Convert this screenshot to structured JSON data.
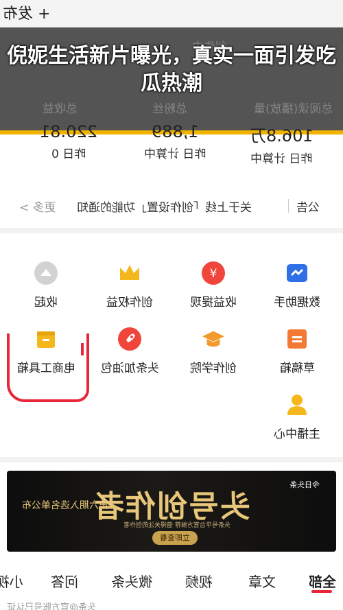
{
  "topbar": {
    "publish_label": "+ 发布"
  },
  "overlay": {
    "caption": "倪妮生活新片曝光，真实一面引发吃瓜热潮",
    "ghost_texts": [
      "创作中",
      "总阅读(播放)量",
      "总粉丝",
      "总收益"
    ]
  },
  "stats": [
    {
      "value": "106.8万",
      "label": "昨日 计算中"
    },
    {
      "value": "1,889",
      "label": "昨日 计算中"
    },
    {
      "value": "220.81",
      "label": "昨日 0"
    }
  ],
  "notice": {
    "tag": "公告",
    "text1": "关于上线「创作设置」功能的通知",
    "more": "更多 >"
  },
  "tools": [
    {
      "label": "数据助手",
      "icon": "chart-icon",
      "color": "#2f6fe8"
    },
    {
      "label": "收益提现",
      "icon": "yuan-icon",
      "color": "#f0453a"
    },
    {
      "label": "创作权益",
      "icon": "crown-icon",
      "color": "#f5b81c"
    },
    {
      "label": "收起",
      "icon": "collapse-icon",
      "color": "#bdbdbd"
    },
    {
      "label": "草稿箱",
      "icon": "draft-icon",
      "color": "#f27a35"
    },
    {
      "label": "创作学院",
      "icon": "graduation-icon",
      "color": "#f29a2e"
    },
    {
      "label": "头条加油包",
      "icon": "rocket-icon",
      "color": "#f0453a"
    },
    {
      "label": "电商工具箱",
      "icon": "box-icon",
      "color": "#f5b81c"
    },
    {
      "label": "主播中心",
      "icon": "user-icon",
      "color": "#f5b81c"
    }
  ],
  "banner": {
    "brand": "今日头条",
    "title": "头号创作者",
    "subtitle": "第六期入选名单公布",
    "tiny": "头条号平台官方推荐 值得关注的创作者",
    "button": "立即查看"
  },
  "tabs": [
    "全部",
    "文章",
    "视频",
    "微头条",
    "问答",
    "小视"
  ],
  "bottom_peek": "头条@官方账号已认证",
  "colors": {
    "accent": "#e8263a",
    "overlay_border": "#f0b400"
  }
}
